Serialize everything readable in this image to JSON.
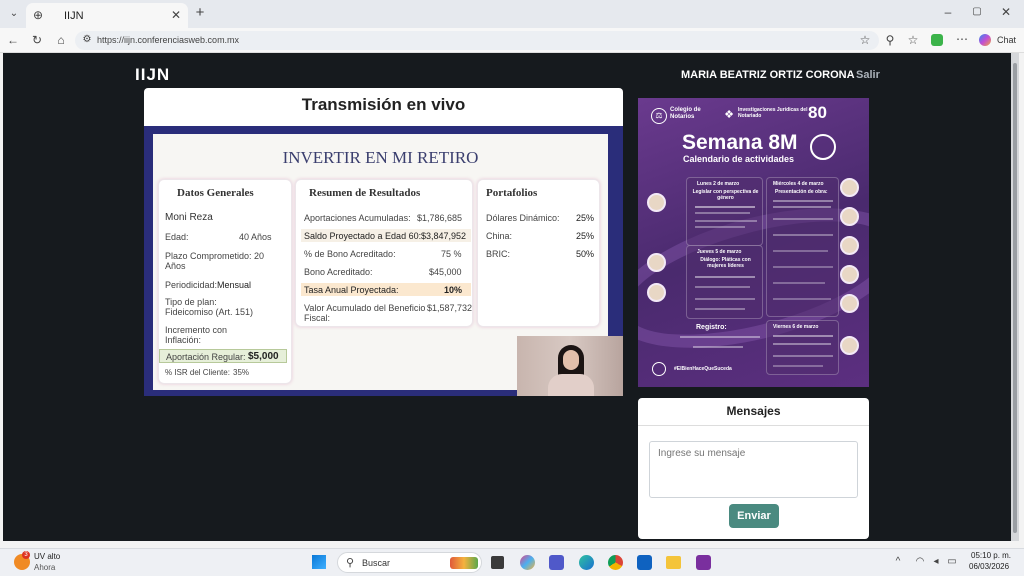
{
  "browser": {
    "tab_title": "IIJN",
    "url": "https://iijn.conferenciasweb.com.mx",
    "chat_label": "Chat"
  },
  "site": {
    "logo": "IIJN",
    "user_name": "MARIA BEATRIZ ORTIZ CORONA",
    "logout": "Salir",
    "live_title": "Transmisión en vivo",
    "messages_title": "Mensajes",
    "message_placeholder": "Ingrese su mensaje",
    "send_button": "Enviar"
  },
  "slide": {
    "title": "INVERTIR EN MI RETIRO",
    "general": {
      "heading": "Datos Generales",
      "name": "Moni Reza",
      "age_label": "Edad:",
      "age_value": "40 Años",
      "term_label": "Plazo Comprometido: 20 Años",
      "periodicity_label": "Periodicidad:",
      "periodicity_value": "Mensual",
      "plan_label": "Tipo de plan: Fideicomiso (Art. 151)",
      "inflation_label": "Incremento con Inflación:",
      "contribution_label": "Aportación Regular:",
      "contribution_value": "$5,000",
      "isr_label": "% ISR del Cliente:",
      "isr_value": "35%"
    },
    "results": {
      "heading": "Resumen de Resultados",
      "rows": [
        {
          "label": "Aportaciones Acumuladas:",
          "value": "$1,786,685"
        },
        {
          "label": "Saldo Proyectado a Edad 60:",
          "value": "$3,847,952"
        },
        {
          "label": "% de Bono Acreditado:",
          "value": "75 %"
        },
        {
          "label": "Bono Acreditado:",
          "value": "$45,000"
        },
        {
          "label": "Tasa Anual Proyectada:",
          "value": "10%"
        },
        {
          "label": "Valor Acumulado del Beneficio Fiscal:",
          "value": "$1,587,732"
        }
      ]
    },
    "portfolio": {
      "heading": "Portafolios",
      "rows": [
        {
          "label": "Dólares Dinámico:",
          "value": "25%"
        },
        {
          "label": "China:",
          "value": "25%"
        },
        {
          "label": "BRIC:",
          "value": "50%"
        }
      ]
    }
  },
  "poster": {
    "org1": "Colegio de Notarios",
    "org2": "Investigaciones Jurídicas del Notariado",
    "anniversary": "80",
    "title": "Semana 8M",
    "subtitle": "Calendario de actividades",
    "day1": "Lunes 2 de marzo",
    "event1": "Legislar con perspectiva de género",
    "day2": "Miércoles 4 de marzo",
    "event2": "Presentación de obra:",
    "day3": "Jueves 5 de marzo",
    "event3": "Diálogo: Pláticas con mujeres líderes",
    "day4": "Viernes 6 de marzo",
    "register": "Registro:",
    "hashtag": "#ElBienHaceQueSuceda"
  },
  "taskbar": {
    "weather_temp": "UV alto",
    "weather_sub": "Ahora",
    "search_placeholder": "Buscar",
    "time": "05:10 p. m.",
    "date": "06/03/2026"
  },
  "colors": {
    "site_bg": "#161a1e",
    "send_button": "#4a8a80",
    "poster_purple": "#5c2f80",
    "slide_border": "#2a2d7a"
  }
}
